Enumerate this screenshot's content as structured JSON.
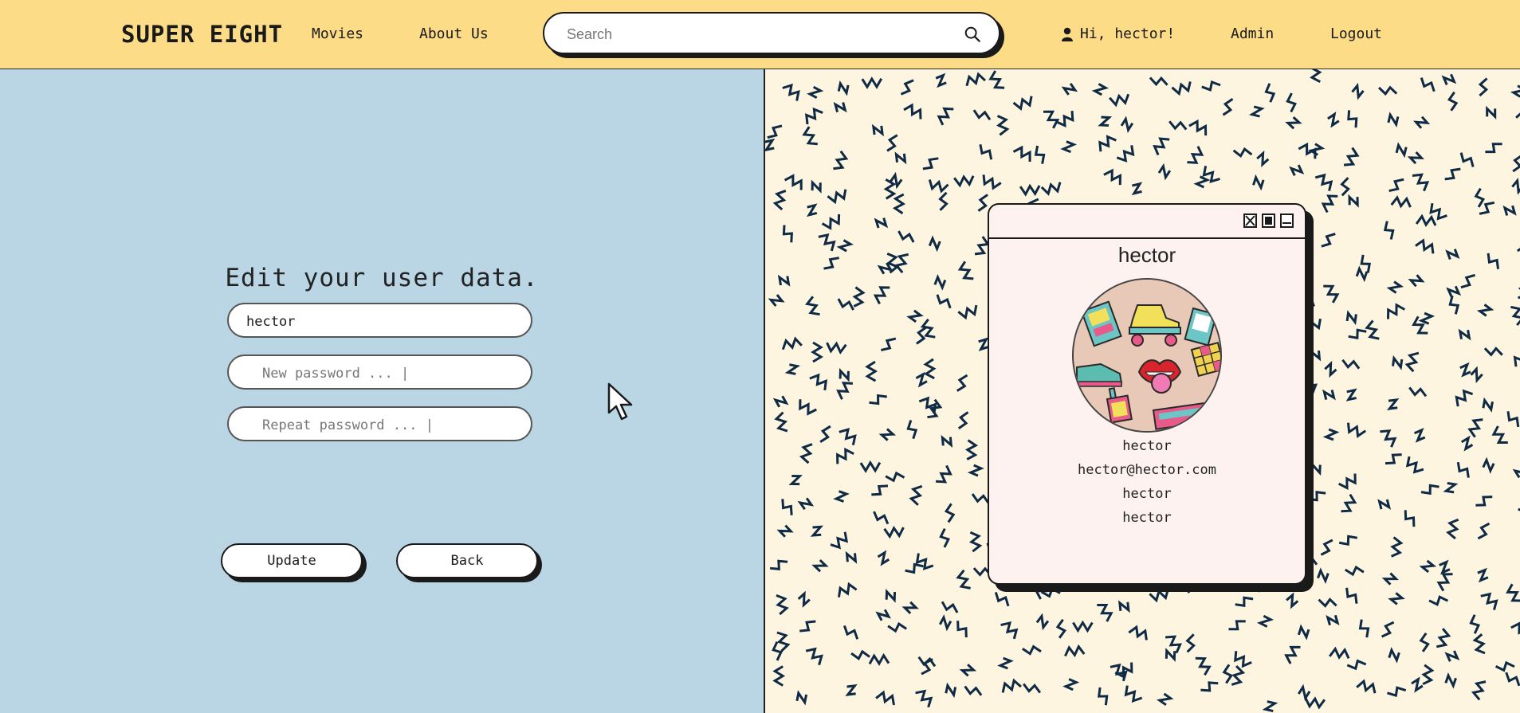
{
  "header": {
    "logo": "SUPER EIGHT",
    "nav": [
      {
        "label": "Movies"
      },
      {
        "label": "About Us"
      }
    ],
    "search": {
      "placeholder": "Search",
      "value": ""
    },
    "greeting": "Hi, hector!",
    "admin_label": "Admin",
    "logout_label": "Logout"
  },
  "form": {
    "title": "Edit your user data.",
    "username_value": "hector",
    "new_password_placeholder": "New password ... |",
    "repeat_password_placeholder": "Repeat password ... |",
    "update_label": "Update",
    "back_label": "Back"
  },
  "profile": {
    "title": "hector",
    "lines": [
      "hector",
      "hector@hector.com",
      "hector",
      "hector"
    ],
    "window_buttons": [
      "close-icon",
      "maximize-icon",
      "minimize-icon"
    ]
  },
  "colors": {
    "header_bg": "#fddc88",
    "left_bg": "#bad6e4",
    "right_bg": "#fdf5e0",
    "pattern": "#0f2a44",
    "card_bg": "#fdf2f0"
  }
}
